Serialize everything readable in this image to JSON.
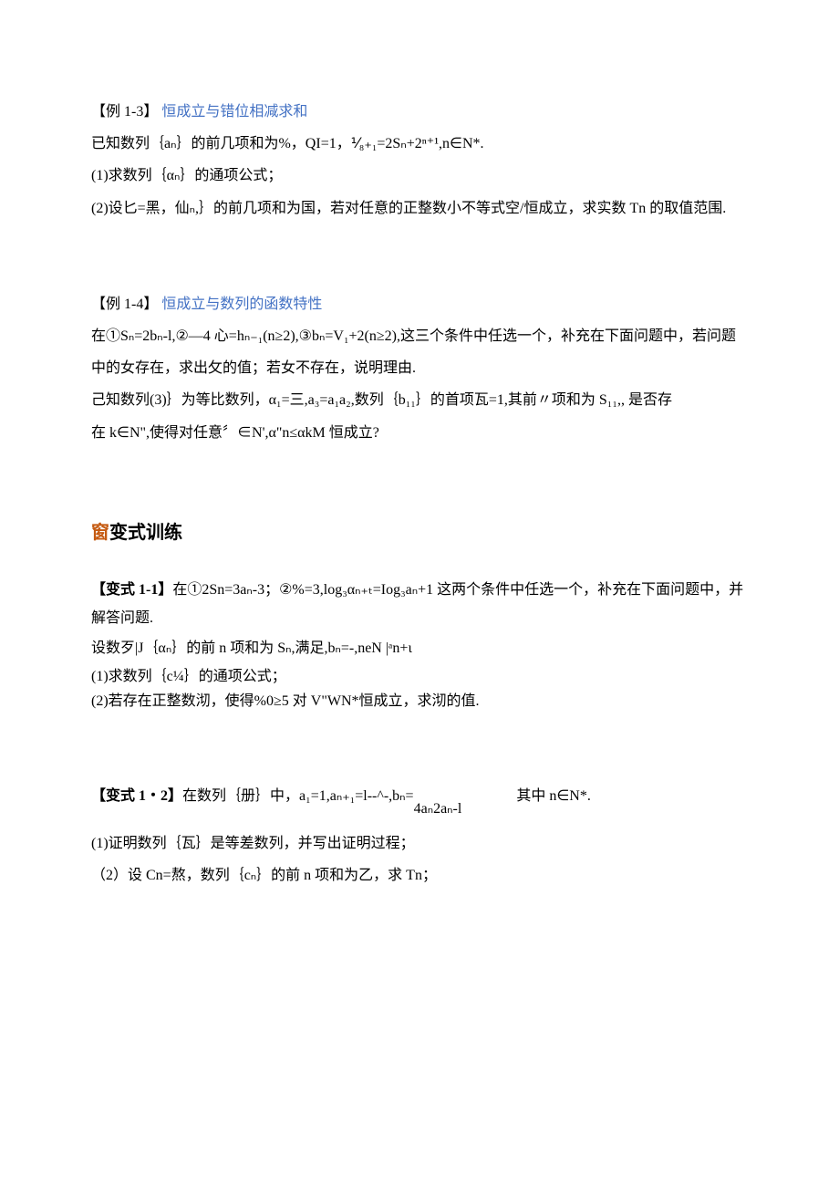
{
  "ex13": {
    "label": "【例 1-3】",
    "title": "恒成立与错位相减求和",
    "line1": "已知数列｛aₙ｝的前几项和为%，QI=1，⅟₈₊₁=2Sₙ+2ⁿ⁺¹,n∈N*.",
    "line2": "(1)求数列｛αₙ｝的通项公式；",
    "line3": "(2)设匕=黑，仙ₙ,｝的前几项和为国，若对任意的正整数小不等式空/恒成立，求实数 Tn 的取值范围."
  },
  "ex14": {
    "label": "【例 1-4】",
    "title": "恒成立与数列的函数特性",
    "line1": "在①Sₙ=2bₙ-l,②—4 心=hₙ₋₁(n≥2),③bₙ=V₁+2(n≥2),这三个条件中任选一个，补充在下面问题中，若问题中的女存在，求出攵的值；若女不存在，说明理由.",
    "line2": "己知数列(3)｝为等比数列，α₁=三,a₃=a₁a₂,数列｛b₁₁｝的首项瓦=1,其前〃项和为 S₁₁,, 是否存",
    "line3": "在 k∈N\",使得对任意〞∈N',α\"n≤αkM 恒成立?"
  },
  "section": {
    "word": "窗",
    "rest": "变式训练"
  },
  "var11": {
    "label": "【变式 1-1】",
    "line1": "在①2Sn=3aₙ-3；②%=3,log₃αₙ₊ₜ=Iog₃aₙ+1 这两个条件中任选一个，补充在下面问题中，并解答问题.",
    "line2": "设数歹|J｛αₙ｝的前 n 项和为 Sₙ,满足,bₙ=-,neN |ᵃn+ι",
    "line3": "(1)求数列｛c¼｝的通项公式；",
    "line4": "(2)若存在正整数沏，使得%0≥5 对 V\"WN*恒成立，求沏的值."
  },
  "var12": {
    "label": "【变式 1・2】",
    "line1a": "在数列｛册｝中，a₁=1,aₙ₊₁=l--^-,bₙ=",
    "frac": "4aₙ2aₙ-l",
    "line1b": "其中 n∈N*.",
    "line2": "(1)证明数列｛瓦｝是等差数列，并写出证明过程；",
    "line3": "（2）设 Cn=熬，数列｛cₙ｝的前 n 项和为乙，求 Tn；"
  }
}
